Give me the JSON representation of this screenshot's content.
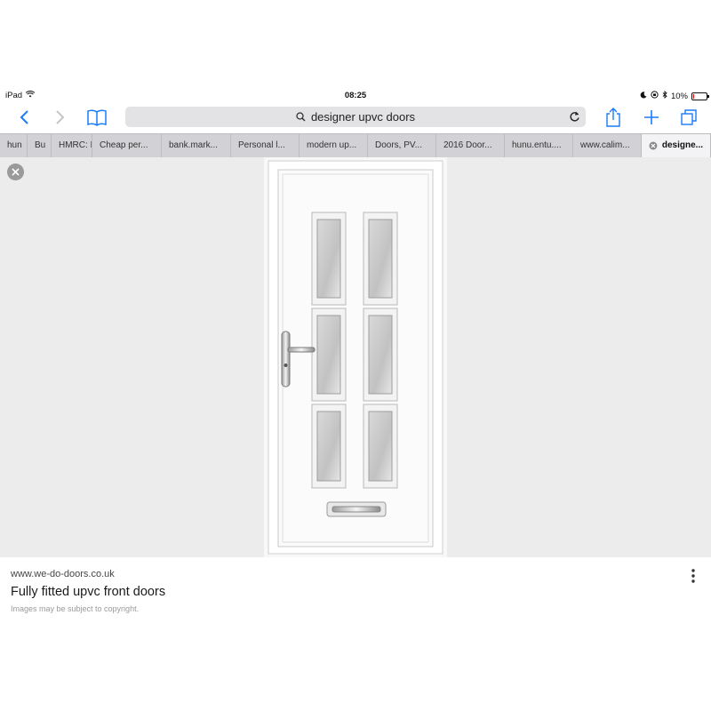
{
  "status_bar": {
    "device": "iPad",
    "time": "08:25",
    "battery": "10%",
    "battery_level": 0.1
  },
  "nav": {
    "search_query": "designer upvc doors",
    "icons": [
      "back-icon",
      "forward-icon",
      "bookmarks-icon",
      "search-icon",
      "reload-icon",
      "share-icon",
      "new-tab-icon",
      "tabs-icon"
    ]
  },
  "tabs": [
    {
      "label": "hun"
    },
    {
      "label": "Bu"
    },
    {
      "label": "HMRC: I"
    },
    {
      "label": "Cheap per..."
    },
    {
      "label": "bank.mark..."
    },
    {
      "label": "Personal l..."
    },
    {
      "label": "modern up..."
    },
    {
      "label": "Doors, PV..."
    },
    {
      "label": "2016 Door..."
    },
    {
      "label": "hunu.entu...."
    },
    {
      "label": "www.calim..."
    },
    {
      "label": "designe..."
    }
  ],
  "result": {
    "domain": "www.we-do-doors.co.uk",
    "title": "Fully fitted upvc front doors",
    "note": "Images may be subject to copyright."
  },
  "colors": {
    "accent": "#1a7cf5",
    "tab_strip": "#d2d2d6",
    "viewer_bg": "#ececec"
  }
}
